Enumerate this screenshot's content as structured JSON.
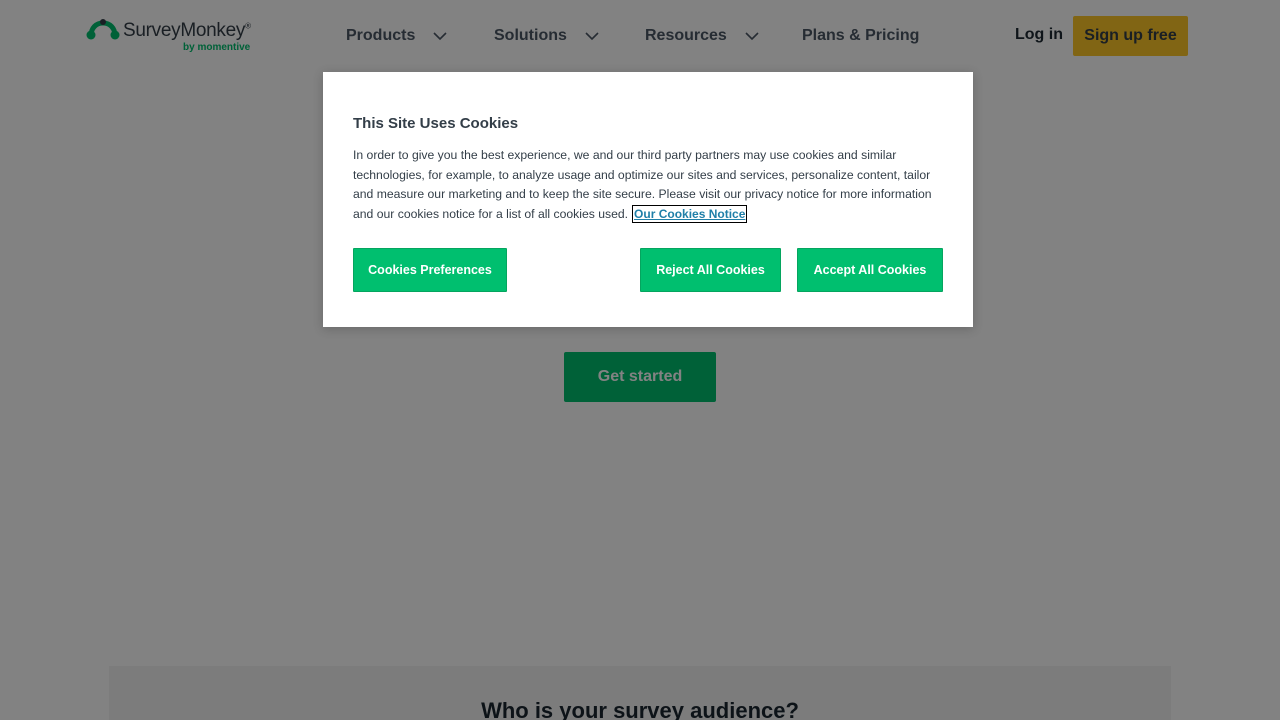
{
  "header": {
    "logo": {
      "name": "SurveyMonkey",
      "reg_mark": "®",
      "tagline": "by momentive",
      "icon": "monkey-logo-icon",
      "brand_color": "#00bf6f"
    },
    "nav": [
      {
        "label": "Products",
        "icon": "chevron-down-icon"
      },
      {
        "label": "Solutions",
        "icon": "chevron-down-icon"
      },
      {
        "label": "Resources",
        "icon": "chevron-down-icon"
      },
      {
        "label": "Plans & Pricing"
      }
    ],
    "login_label": "Log in",
    "signup_label": "Sign up free",
    "signup_color": "#fdc628"
  },
  "main": {
    "get_started_label": "Get started",
    "audience_heading": "Who is your survey audience?"
  },
  "cookie_modal": {
    "title": "This Site Uses Cookies",
    "body": "In order to give you the best experience, we and our third party partners may use cookies and similar technologies, for example, to analyze usage and optimize our sites and services, personalize content, tailor and measure our marketing and to keep the site secure. Please visit our privacy notice for more information and our cookies notice for a list of all cookies used.",
    "notice_link": "Our Cookies Notice",
    "preferences_label": "Cookies Preferences",
    "reject_label": "Reject All Cookies",
    "accept_label": "Accept All Cookies",
    "button_color": "#00bf6f"
  }
}
